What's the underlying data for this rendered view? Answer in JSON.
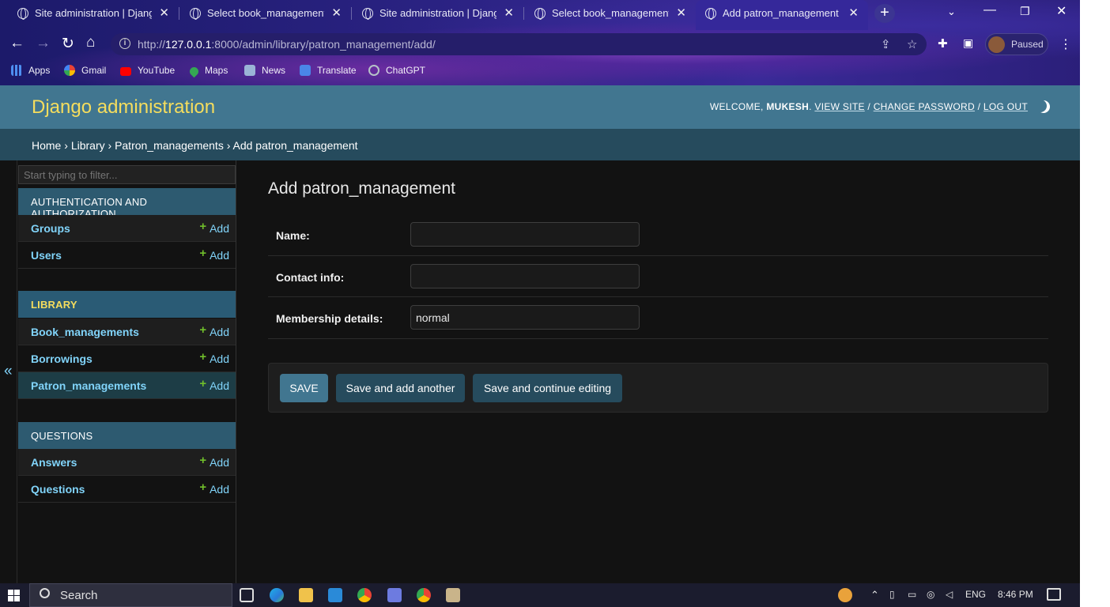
{
  "browser": {
    "tabs": [
      {
        "title": "Site administration | Django"
      },
      {
        "title": "Select book_management to"
      },
      {
        "title": "Site administration | Django"
      },
      {
        "title": "Select book_management to"
      },
      {
        "title": "Add patron_management | D"
      }
    ],
    "url_host": "127.0.0.1",
    "url_prefix": "http://",
    "url_rest": ":8000/admin/library/patron_management/add/",
    "profile_label": "Paused",
    "bookmarks": [
      {
        "label": "Apps",
        "icon": "apps-grid-icon"
      },
      {
        "label": "Gmail",
        "icon": "google-icon"
      },
      {
        "label": "YouTube",
        "icon": "youtube-icon"
      },
      {
        "label": "Maps",
        "icon": "maps-icon"
      },
      {
        "label": "News",
        "icon": "news-icon"
      },
      {
        "label": "Translate",
        "icon": "translate-icon"
      },
      {
        "label": "ChatGPT",
        "icon": "chatgpt-icon"
      }
    ]
  },
  "header": {
    "branding": "Django administration",
    "welcome": "WELCOME,",
    "username": "MUKESH",
    "view_site": "VIEW SITE",
    "change_password": "CHANGE PASSWORD",
    "log_out": "LOG OUT"
  },
  "breadcrumbs": {
    "home": "Home",
    "app": "Library",
    "model": "Patron_managements",
    "current": "Add patron_management"
  },
  "sidebar": {
    "filter_placeholder": "Start typing to filter...",
    "collapse_glyph": "«",
    "add_label": "Add",
    "modules": [
      {
        "caption": "AUTHENTICATION AND AUTHORIZATION",
        "models": [
          "Groups",
          "Users"
        ]
      },
      {
        "caption": "LIBRARY",
        "models": [
          "Book_managements",
          "Borrowings",
          "Patron_managements"
        ]
      },
      {
        "caption": "QUESTIONS",
        "models": [
          "Answers",
          "Questions"
        ]
      }
    ]
  },
  "content": {
    "title": "Add patron_management",
    "fields": [
      {
        "label": "Name:",
        "value": ""
      },
      {
        "label": "Contact info:",
        "value": ""
      },
      {
        "label": "Membership details:",
        "value": "normal"
      }
    ],
    "buttons": {
      "save": "SAVE",
      "save_add_another": "Save and add another",
      "save_continue": "Save and continue editing"
    }
  },
  "taskbar": {
    "search_label": "Search",
    "language": "ENG",
    "time": "8:46 PM"
  },
  "colors": {
    "header": "#417690",
    "breadcrumbs": "#264b5d",
    "branding": "#f5dd5d",
    "link": "#81d4fa",
    "add_plus": "#70bf2b"
  }
}
